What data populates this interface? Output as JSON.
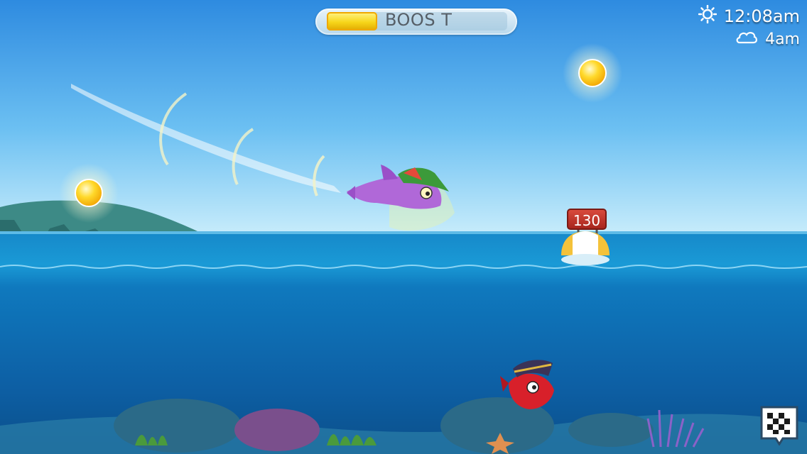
{
  "boost": {
    "label": "BOOS T",
    "level": 0.28
  },
  "clock": {
    "time": "12:08am",
    "time_icon": "sun-icon",
    "forecast": "4am",
    "forecast_icon": "cloud-icon"
  },
  "buoy": {
    "distance": "130"
  },
  "finish_button": {
    "icon": "checkered-flag-icon"
  },
  "colors": {
    "sky_top": "#2f8fdc",
    "sea": "#0c6fb8",
    "boost_fill": "#f7d61a"
  }
}
